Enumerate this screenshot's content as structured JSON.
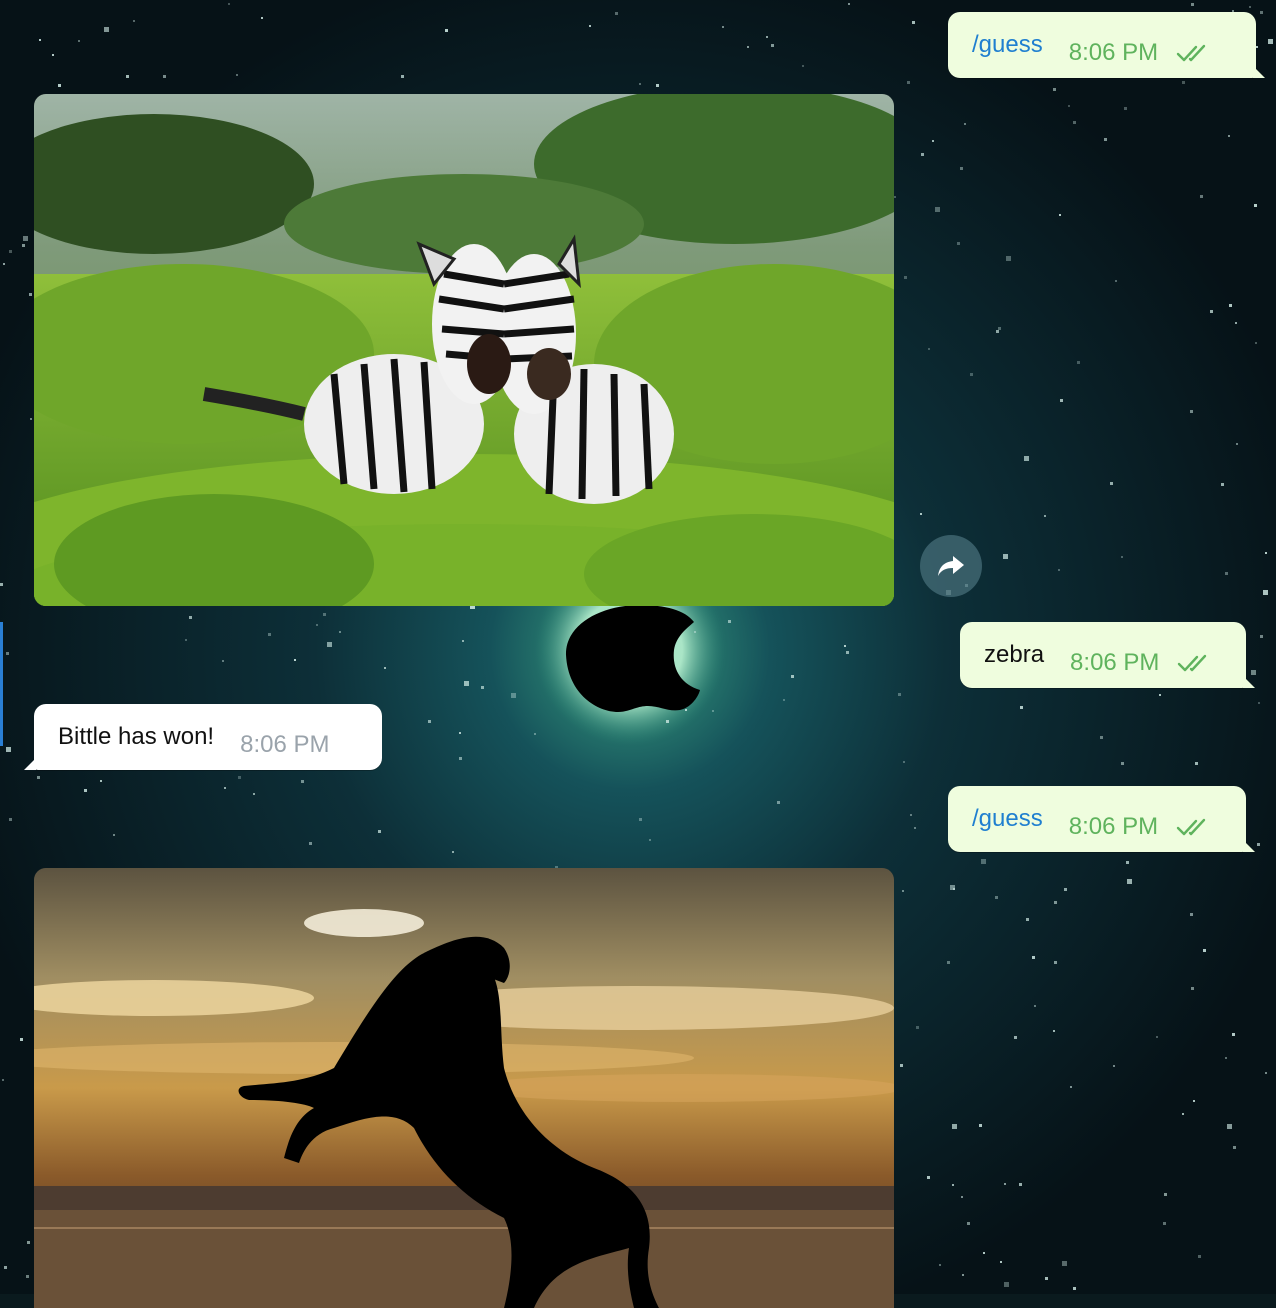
{
  "chat": {
    "messages": [
      {
        "direction": "outgoing",
        "type": "text",
        "text": "/guess",
        "time": "8:06 PM",
        "status": "read",
        "is_command": true
      },
      {
        "direction": "incoming",
        "type": "photo",
        "image": "zebras-photo",
        "action": "share-icon"
      },
      {
        "direction": "outgoing",
        "type": "text",
        "text": "zebra",
        "time": "8:06 PM",
        "status": "read",
        "is_command": false
      },
      {
        "direction": "incoming",
        "type": "text",
        "text": "Bittle has won!",
        "time": "8:06 PM"
      },
      {
        "direction": "outgoing",
        "type": "text",
        "text": "/guess",
        "time": "8:06 PM",
        "status": "read",
        "is_command": true
      },
      {
        "direction": "incoming",
        "type": "photo",
        "image": "horse-silhouette-photo"
      }
    ]
  },
  "colors": {
    "outgoing_bubble": "#effdde",
    "incoming_bubble": "#ffffff",
    "command_text": "#1f7fd0",
    "outgoing_time": "#5fb35d",
    "incoming_time": "#9aa3ab"
  }
}
